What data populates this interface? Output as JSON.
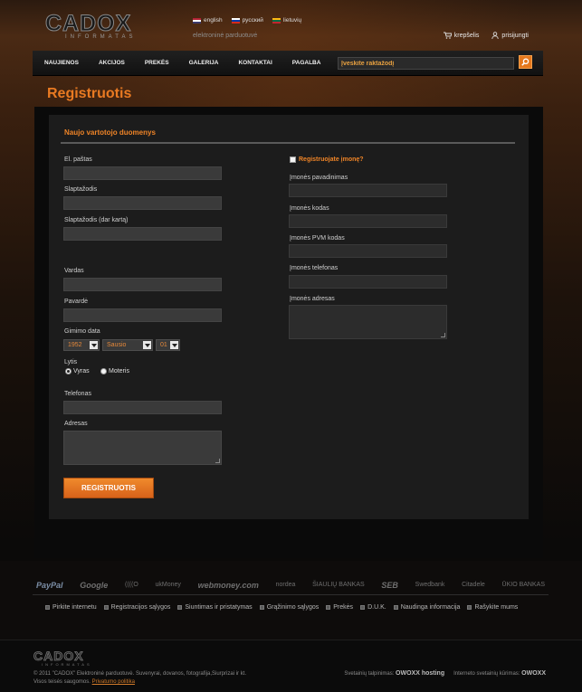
{
  "header": {
    "logo_text": "CADOX",
    "logo_sub": "INFORMATAS",
    "tagline": "elektroninė parduotuvė",
    "languages": [
      {
        "label": "english",
        "flag_colors": [
          "#b22234",
          "#ffffff",
          "#3c3b6e"
        ]
      },
      {
        "label": "русский",
        "flag_colors": [
          "#ffffff",
          "#0039a6",
          "#d52b1e"
        ]
      },
      {
        "label": "lietuvių",
        "flag_colors": [
          "#fdb913",
          "#006a44",
          "#c1272d"
        ]
      }
    ],
    "cart_label": "krepšelis",
    "login_label": "prisijungti"
  },
  "nav": {
    "items": [
      "NAUJIENOS",
      "AKCIJOS",
      "PREKĖS",
      "GALERIJA",
      "KONTAKTAI",
      "PAGALBA"
    ],
    "search_placeholder": "Įveskite raktažodį"
  },
  "page": {
    "title": "Registruotis",
    "section_title": "Naujo vartotojo duomenys"
  },
  "form": {
    "email_label": "El. paštas",
    "password_label": "Slaptažodis",
    "password_repeat_label": "Slaptažodis (dar kartą)",
    "first_name_label": "Vardas",
    "last_name_label": "Pavardė",
    "birth_label": "Gimimo data",
    "birth_year": "1952",
    "birth_month": "Sausio",
    "birth_day": "01",
    "gender_label": "Lytis",
    "gender_male": "Vyras",
    "gender_female": "Moteris",
    "phone_label": "Telefonas",
    "address_label": "Adresas",
    "company_checkbox_label": "Registruojate įmonę?",
    "company_name_label": "Įmonės pavadinimas",
    "company_code_label": "Įmonės kodas",
    "company_vat_label": "Įmonės PVM kodas",
    "company_phone_label": "Įmonės telefonas",
    "company_address_label": "Įmonės adresas",
    "submit_label": "REGISTRUOTIS"
  },
  "partners": [
    "PayPal",
    "Google",
    "((((O",
    "ukMoney",
    "webmoney.com",
    "nordea",
    "ŠIAULIŲ BANKAS",
    "SEB",
    "Swedbank",
    "Citadele",
    "ŪKIO BANKAS"
  ],
  "footer": {
    "links": [
      "Pirkite internetu",
      "Registracijos sąlygos",
      "Siuntimas ir pristatymas",
      "Grąžinimo sąlygos",
      "Prekės",
      "D.U.K.",
      "Naudinga informacija",
      "Rašykite mums"
    ],
    "logo_text": "CADOX",
    "logo_sub": "INFORMATAS",
    "copyright": "© 2011 \"CADOX\" Elektroninė parduotuvė. Suvenyrai, dovanos, fotografija,Siurprizai ir kt.",
    "rights": "Visos teisės saugomos.",
    "privacy": "Privatumo politika",
    "hosting_label": "Svetainių talpinimas:",
    "hosting_brand": "OWOXX hosting",
    "dev_label": "Interneto svetainių kūrimas:",
    "dev_brand": "OWOXX"
  },
  "colors": {
    "accent": "#e97a22",
    "nav_bg": "#1a1a1a",
    "field_bg": "#3a3a3a"
  }
}
